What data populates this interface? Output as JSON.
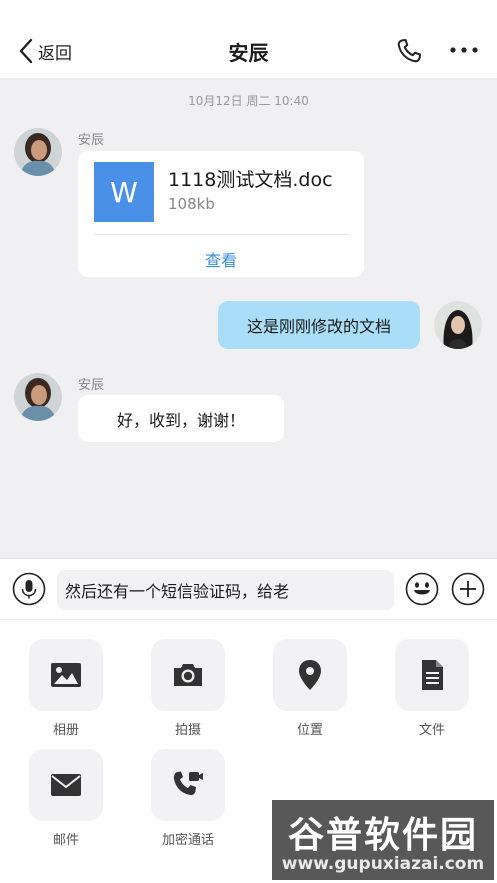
{
  "header": {
    "back_label": "返回",
    "title": "安辰"
  },
  "chat": {
    "timestamp": "10月12日 周二 10:40",
    "messages": [
      {
        "sender": "安辰",
        "file": {
          "icon_letter": "W",
          "name": "1118测试文档.doc",
          "size": "108kb",
          "action": "查看"
        }
      },
      {
        "text": "这是刚刚修改的文档"
      },
      {
        "sender": "安辰",
        "text": "好，收到，谢谢！"
      }
    ]
  },
  "composer": {
    "value": "然后还有一个短信验证码，给老"
  },
  "tools": [
    {
      "label": "相册",
      "icon": "image-icon"
    },
    {
      "label": "拍摄",
      "icon": "camera-icon"
    },
    {
      "label": "位置",
      "icon": "location-pin-icon"
    },
    {
      "label": "文件",
      "icon": "document-icon"
    },
    {
      "label": "邮件",
      "icon": "mail-icon"
    },
    {
      "label": "加密通话",
      "icon": "video-call-icon"
    }
  ],
  "watermark": {
    "main": "谷普软件园",
    "sub": "www.gupuxiazai.com"
  },
  "colors": {
    "chat_bg": "#f0f0f3",
    "outgoing_bubble": "#a9ddf8",
    "link": "#3a8fd9",
    "file_icon": "#4a90e8"
  }
}
